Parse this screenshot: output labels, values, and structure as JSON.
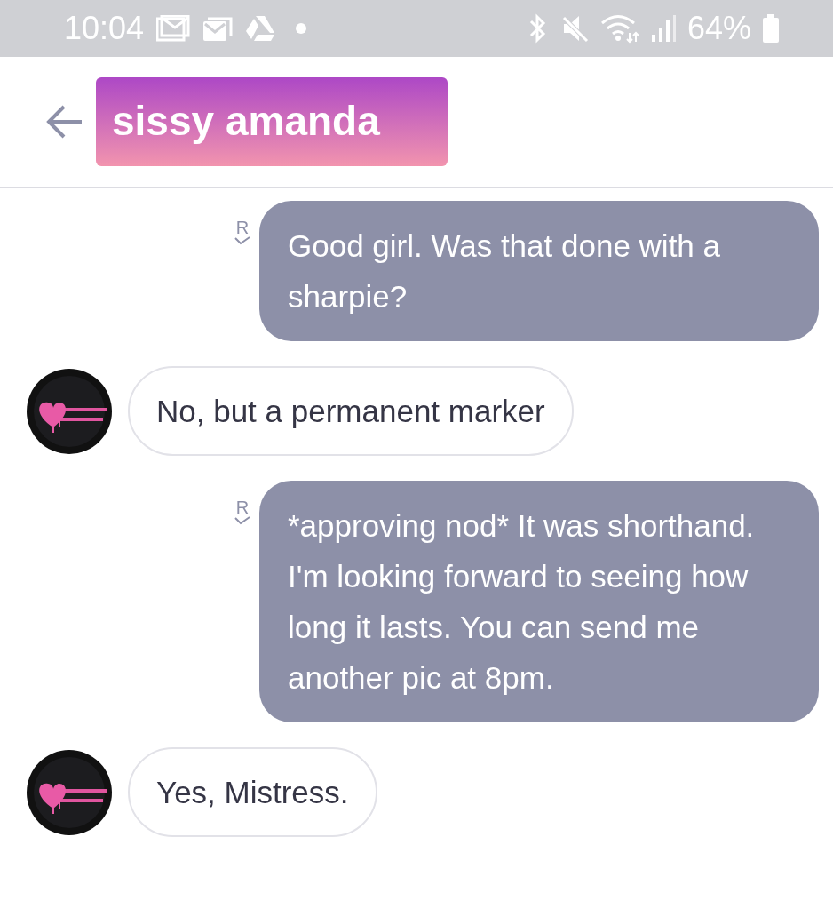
{
  "status_bar": {
    "time": "10:04",
    "battery": "64%"
  },
  "header": {
    "title": "sissy amanda"
  },
  "messages": [
    {
      "kind": "sent",
      "text": "Good girl. Was that done with a sharpie?",
      "receipt": "R"
    },
    {
      "kind": "received",
      "text": "No, but a permanent marker"
    },
    {
      "kind": "sent",
      "text": "*approving nod* It was shorthand. I'm looking forward to seeing how long it lasts. You can send me another pic at 8pm.",
      "receipt": "R"
    },
    {
      "kind": "received",
      "text": "Yes, Mistress."
    }
  ]
}
